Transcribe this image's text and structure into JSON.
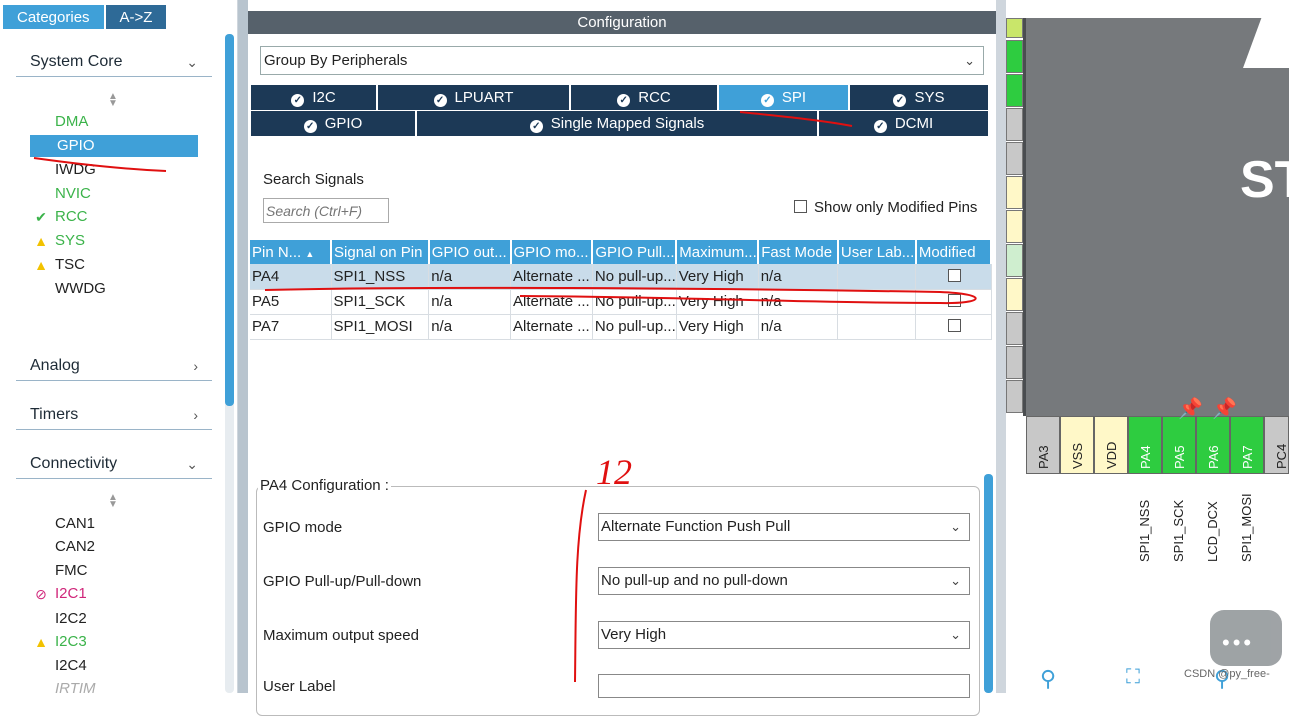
{
  "left_panel": {
    "tabs": [
      {
        "label": "Categories",
        "active": true
      },
      {
        "label": "A->Z",
        "active": false
      }
    ],
    "categories": {
      "system_core": "System Core",
      "analog": "Analog",
      "timers": "Timers",
      "connectivity": "Connectivity"
    },
    "system_core_items": [
      {
        "label": "DMA",
        "status": "ok-color",
        "icon": ""
      },
      {
        "label": "GPIO",
        "status": "selected",
        "icon": ""
      },
      {
        "label": "IWDG",
        "status": "default",
        "icon": ""
      },
      {
        "label": "NVIC",
        "status": "ok-color",
        "icon": ""
      },
      {
        "label": "RCC",
        "status": "ok",
        "icon": "check-icon"
      },
      {
        "label": "SYS",
        "status": "warning",
        "icon": "warning-icon"
      },
      {
        "label": "TSC",
        "status": "warning",
        "icon": "warning-icon"
      },
      {
        "label": "WWDG",
        "status": "default",
        "icon": ""
      }
    ],
    "connectivity_items": [
      {
        "label": "CAN1",
        "status": "default",
        "icon": ""
      },
      {
        "label": "CAN2",
        "status": "default",
        "icon": ""
      },
      {
        "label": "FMC",
        "status": "default",
        "icon": ""
      },
      {
        "label": "I2C1",
        "status": "error",
        "icon": "disabled-icon"
      },
      {
        "label": "I2C2",
        "status": "default",
        "icon": ""
      },
      {
        "label": "I2C3",
        "status": "warning",
        "icon": "warning-icon"
      },
      {
        "label": "I2C4",
        "status": "default",
        "icon": ""
      },
      {
        "label": "IRTIM",
        "status": "disabled",
        "icon": ""
      }
    ]
  },
  "center": {
    "title": "Configuration",
    "group_by": "Group By Peripherals",
    "peripheral_tabs_row1": [
      {
        "label": "I2C",
        "active": false
      },
      {
        "label": "LPUART",
        "active": false
      },
      {
        "label": "RCC",
        "active": false
      },
      {
        "label": "SPI",
        "active": true
      },
      {
        "label": "SYS",
        "active": false
      }
    ],
    "peripheral_tabs_row2": [
      {
        "label": "GPIO",
        "active": false
      },
      {
        "label": "Single Mapped Signals",
        "active": false
      },
      {
        "label": "DCMI",
        "active": false
      }
    ],
    "search": {
      "label": "Search Signals",
      "placeholder": "Search (Ctrl+F)"
    },
    "show_modified_label": "Show only Modified Pins",
    "table": {
      "headers": [
        "Pin N...",
        "Signal on Pin",
        "GPIO out...",
        "GPIO mo...",
        "GPIO Pull...",
        "Maximum...",
        "Fast Mode",
        "User Lab...",
        "Modified"
      ],
      "rows": [
        {
          "pin": "PA4",
          "signal": "SPI1_NSS",
          "gpio_out": "n/a",
          "gpio_mode": "Alternate ...",
          "pull": "No pull-up...",
          "max_speed": "Very High",
          "fast_mode": "n/a",
          "user_label": "",
          "modified": false,
          "selected": true
        },
        {
          "pin": "PA5",
          "signal": "SPI1_SCK",
          "gpio_out": "n/a",
          "gpio_mode": "Alternate ...",
          "pull": "No pull-up...",
          "max_speed": "Very High",
          "fast_mode": "n/a",
          "user_label": "",
          "modified": false,
          "selected": false
        },
        {
          "pin": "PA7",
          "signal": "SPI1_MOSI",
          "gpio_out": "n/a",
          "gpio_mode": "Alternate ...",
          "pull": "No pull-up...",
          "max_speed": "Very High",
          "fast_mode": "n/a",
          "user_label": "",
          "modified": false,
          "selected": false
        }
      ]
    },
    "pin_config": {
      "legend": "PA4 Configuration :",
      "gpio_mode_label": "GPIO mode",
      "gpio_mode_value": "Alternate Function Push Pull",
      "pull_label": "GPIO Pull-up/Pull-down",
      "pull_value": "No pull-up and no pull-down",
      "speed_label": "Maximum output speed",
      "speed_value": "Very High",
      "user_label_label": "User Label",
      "user_label_value": ""
    }
  },
  "chip_view": {
    "logo_text": "ST",
    "bottom_pins": [
      {
        "name": "PA3",
        "color": "#c8c8c8"
      },
      {
        "name": "VSS",
        "color": "#fff8c8"
      },
      {
        "name": "VDD",
        "color": "#fff8c8"
      },
      {
        "name": "PA4",
        "color": "#2ecc40"
      },
      {
        "name": "PA5",
        "color": "#2ecc40"
      },
      {
        "name": "PA6",
        "color": "#2ecc40"
      },
      {
        "name": "PA7",
        "color": "#2ecc40"
      },
      {
        "name": "PC4",
        "color": "#c8c8c8"
      }
    ],
    "signal_labels": [
      "SPI1_NSS",
      "SPI1_SCK",
      "LCD_DCX",
      "SPI1_MOSI"
    ],
    "watermark": "CSDN @py_free-"
  },
  "annotation": {
    "handwritten_number": "12"
  },
  "colors": {
    "accent": "#3fa0d8",
    "tab_dark": "#1c3956",
    "header": "#56616b",
    "ok_green": "#3bb34a",
    "warning_yellow": "#f2c200",
    "error_pink": "#d0267a",
    "annotation_red": "#e01010"
  }
}
